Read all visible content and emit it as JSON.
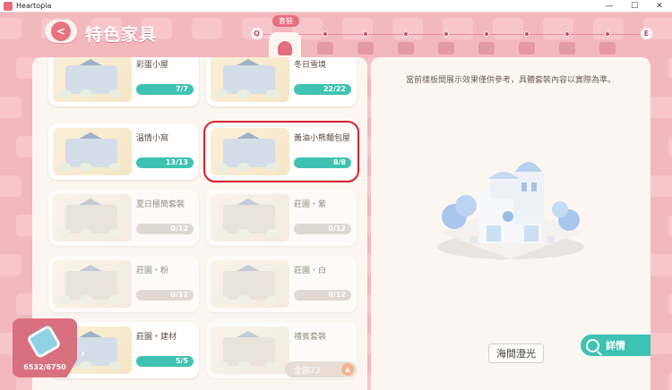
{
  "window": {
    "title": "Heartopia",
    "controls": [
      "—",
      "☐",
      "✕"
    ]
  },
  "header": {
    "title": "特色家具",
    "back_label": "<"
  },
  "categories": {
    "left_key": "Q",
    "right_key": "E",
    "active_label": "套裝",
    "tabs": [
      {
        "name": "set",
        "active": true
      },
      {
        "name": "bed",
        "active": false
      },
      {
        "name": "cabinet",
        "active": false
      },
      {
        "name": "bathtub",
        "active": false
      },
      {
        "name": "table",
        "active": false
      },
      {
        "name": "lamp",
        "active": false
      },
      {
        "name": "drawer",
        "active": false
      },
      {
        "name": "plush",
        "active": false
      },
      {
        "name": "wall",
        "active": false
      }
    ]
  },
  "sets": [
    {
      "name": "彩蛋小屋",
      "count": "7/7",
      "progress": 1.0,
      "faded": false,
      "selected": false
    },
    {
      "name": "冬日雪境",
      "count": "22/22",
      "progress": 1.0,
      "faded": false,
      "selected": false
    },
    {
      "name": "溫情小窩",
      "count": "13/13",
      "progress": 1.0,
      "faded": false,
      "selected": false
    },
    {
      "name": "黃油小熊麵包屋",
      "count": "8/8",
      "progress": 1.0,
      "faded": false,
      "selected": true
    },
    {
      "name": "夏日極簡套裝",
      "count": "0/12",
      "progress": 0,
      "faded": true,
      "selected": false
    },
    {
      "name": "莊園・紫",
      "count": "0/12",
      "progress": 0,
      "faded": true,
      "selected": false
    },
    {
      "name": "莊園・粉",
      "count": "0/12",
      "progress": 0,
      "faded": true,
      "selected": false
    },
    {
      "name": "莊園・白",
      "count": "0/12",
      "progress": 0,
      "faded": true,
      "selected": false
    },
    {
      "name": "莊園・建材",
      "count": "5/5",
      "progress": 1.0,
      "faded": false,
      "selected": false
    },
    {
      "name": "禮賓套裝",
      "count": "",
      "progress": 0,
      "faded": true,
      "selected": false
    }
  ],
  "filter": {
    "label": "全部73"
  },
  "detail": {
    "notice": "當前樣板間展示效果僅供參考，具體套裝內容以實際為準。",
    "set_name": "海間澄光",
    "detail_button": "詳情"
  },
  "currency": {
    "value": "6532/6750"
  },
  "colors": {
    "accent": "#3ec2b2",
    "brand": "#e5707e",
    "selection": "#d8232f",
    "panel": "#fcf6f1"
  }
}
